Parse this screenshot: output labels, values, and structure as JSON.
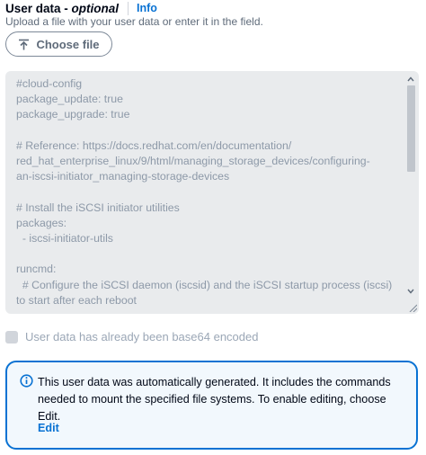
{
  "field": {
    "label": "User data - ",
    "label_optional": "optional",
    "info_link": "Info",
    "description": "Upload a file with your user data or enter it in the field.",
    "choose_file_label": "Choose file"
  },
  "user_data_text": "#cloud-config\npackage_update: true\npackage_upgrade: true\n\n# Reference: https://docs.redhat.com/en/documentation/\nred_hat_enterprise_linux/9/html/managing_storage_devices/configuring-\nan-iscsi-initiator_managing-storage-devices\n\n# Install the iSCSI initiator utilities\npackages:\n  - iscsi-initiator-utils\n\nruncmd:\n  # Configure the iSCSI daemon (iscsid) and the iSCSI startup process (iscsi)\nto start after each reboot",
  "base64_checkbox": {
    "label": "User data has already been base64 encoded",
    "checked": false
  },
  "alert": {
    "message": "This user data was automatically generated. It includes the commands needed to mount the specified file systems. To enable editing, choose Edit.",
    "edit_link": "Edit"
  },
  "colors": {
    "link": "#0972d3",
    "alert_border": "#0972d3",
    "alert_background": "#f2f8fd",
    "disabled_field": "#e9ebed"
  },
  "icons": {
    "upload": "upload-arrow-icon",
    "info": "info-circle-icon"
  }
}
